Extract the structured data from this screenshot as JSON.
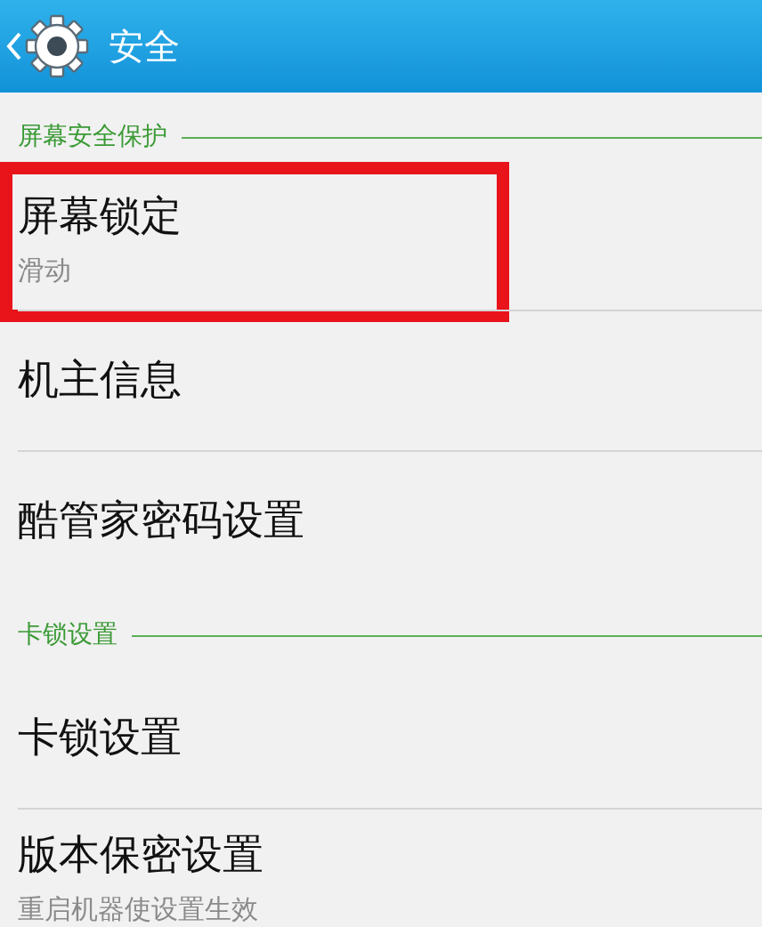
{
  "header": {
    "title": "安全"
  },
  "sections": [
    {
      "title": "屏幕安全保护",
      "items": [
        {
          "title": "屏幕锁定",
          "subtitle": "滑动",
          "highlighted": true
        },
        {
          "title": "机主信息",
          "highlighted": false
        },
        {
          "title": "酷管家密码设置",
          "highlighted": false
        }
      ]
    },
    {
      "title": "卡锁设置",
      "items": [
        {
          "title": "卡锁设置",
          "highlighted": false
        },
        {
          "title": "版本保密设置",
          "subtitle": "重启机器使设置生效",
          "highlighted": false
        }
      ]
    }
  ]
}
